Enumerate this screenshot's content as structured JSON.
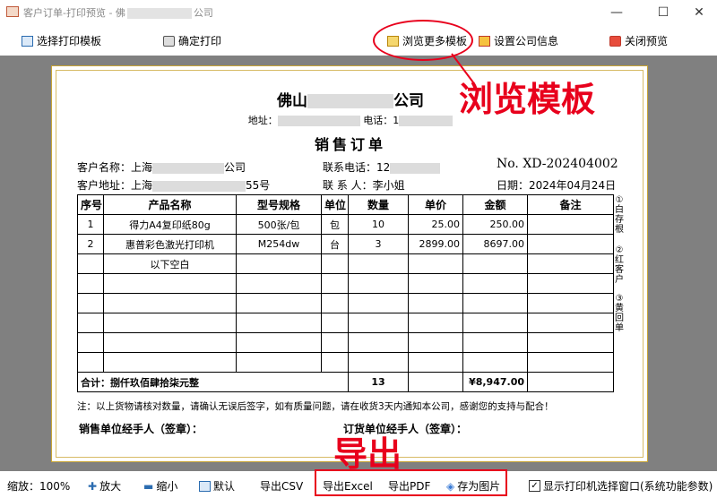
{
  "window": {
    "title_prefix": "客户订单-打印预览 - 佛",
    "title_suffix": "公司",
    "minimize": "—",
    "maximize": "☐",
    "close": "✕"
  },
  "toolbar": {
    "select_template": "选择打印模板",
    "confirm_print": "确定打印",
    "browse_templates": "浏览更多模板",
    "set_company": "设置公司信息",
    "close_preview": "关闭预览"
  },
  "document": {
    "company_prefix": "佛山",
    "company_suffix": "公司",
    "address_label": "地址：",
    "phone_label": "电话：1",
    "title": "销售订单",
    "customer_name_label": "客户名称：上海",
    "customer_name_suffix": "公司",
    "customer_addr_label": "客户地址：上海",
    "customer_addr_suffix": "55号",
    "contact_phone_label": "联系电话：12",
    "contact_person": "联 系 人：李小姐",
    "order_no": "No. XD-202404002",
    "date": "日期：2024年04月24日",
    "columns": [
      "序号",
      "产品名称",
      "型号规格",
      "单位",
      "数量",
      "单价",
      "金额",
      "备注"
    ],
    "rows": [
      [
        "1",
        "得力A4复印纸80g",
        "500张/包",
        "包",
        "10",
        "25.00",
        "250.00",
        ""
      ],
      [
        "2",
        "惠普彩色激光打印机",
        "M254dw",
        "台",
        "3",
        "2899.00",
        "8697.00",
        ""
      ],
      [
        "",
        "以下空白",
        "",
        "",
        "",
        "",
        "",
        ""
      ],
      [
        "",
        "",
        "",
        "",
        "",
        "",
        "",
        ""
      ],
      [
        "",
        "",
        "",
        "",
        "",
        "",
        "",
        ""
      ],
      [
        "",
        "",
        "",
        "",
        "",
        "",
        "",
        ""
      ],
      [
        "",
        "",
        "",
        "",
        "",
        "",
        "",
        ""
      ],
      [
        "",
        "",
        "",
        "",
        "",
        "",
        "",
        ""
      ]
    ],
    "total_label": "合计：捌仟玖佰肆拾柒元整",
    "total_qty": "13",
    "total_amount": "¥8,947.00",
    "side_1": "①白存根",
    "side_2": "②红客户",
    "side_3": "③黄回单",
    "note": "注：以上货物请核对数量，请确认无误后签字，如有质量问题，请在收货3天内通知本公司，感谢您的支持与配合！",
    "sign_seller": "销售单位经手人（签章）：",
    "sign_buyer": "订货单位经手人（签章）："
  },
  "annotations": {
    "browse_label": "浏览模板",
    "export_label": "导出"
  },
  "statusbar": {
    "zoom": "缩放：100%",
    "zoom_in": "放大",
    "zoom_out": "缩小",
    "default": "默认",
    "export_csv": "导出CSV",
    "export_excel": "导出Excel",
    "export_pdf": "导出PDF",
    "save_image": "存为图片",
    "show_printer_dialog": "显示打印机选择窗口(系统功能参数)",
    "show_printer_checked": true
  }
}
